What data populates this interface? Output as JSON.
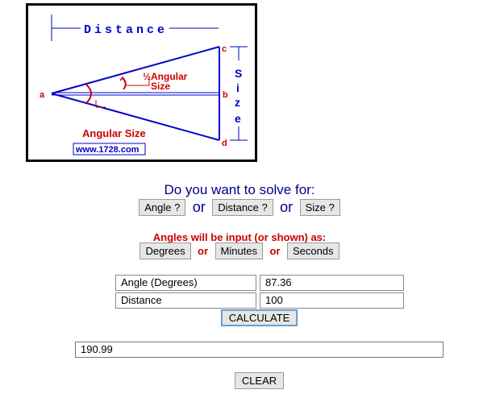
{
  "diagram": {
    "distance_label": "Distance",
    "size_letters": [
      "S",
      "i",
      "z",
      "e"
    ],
    "half_angular_line1": "½Angular",
    "half_angular_line2": "Size",
    "angular_size_label": "Angular Size",
    "point_a": "a",
    "point_b": "b",
    "point_c": "c",
    "point_d": "d",
    "website": "www.1728.com"
  },
  "solve": {
    "prompt": "Do you want to solve for:",
    "angle_button": "Angle ?",
    "distance_button": "Distance ?",
    "size_button": "Size ?",
    "or": "or"
  },
  "units": {
    "label": "Angles will be input (or shown) as:",
    "degrees_button": "Degrees",
    "minutes_button": "Minutes",
    "seconds_button": "Seconds",
    "or": "or"
  },
  "form": {
    "angle_label": "Angle (Degrees)",
    "angle_value": "87.36",
    "distance_label": "Distance",
    "distance_value": "100",
    "calculate_button": "CALCULATE"
  },
  "result": {
    "value": "190.99"
  },
  "clear_button": "CLEAR",
  "colors": {
    "navy": "#00008b",
    "red": "#cc0000",
    "diagram_blue": "#0000cc"
  }
}
